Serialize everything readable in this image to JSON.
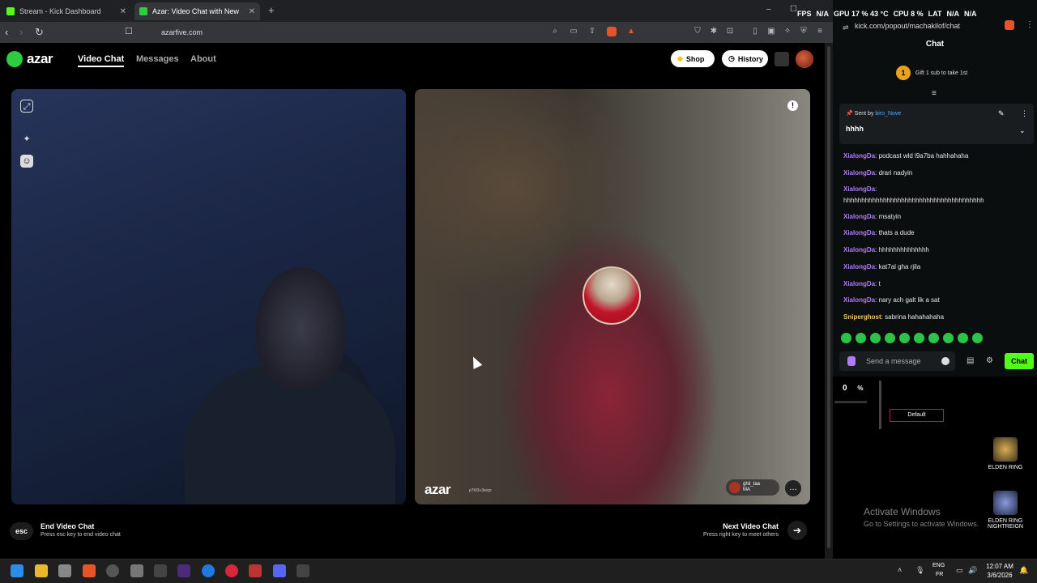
{
  "browser": {
    "tabs": [
      {
        "title": "Stream - Kick Dashboard",
        "favicon_color": "#53fc18"
      },
      {
        "title": "Azar: Video Chat with New Pe",
        "favicon_color": "#2ecc40"
      }
    ],
    "new_tab": "+",
    "url": "azarfive.com",
    "window_controls": [
      "–",
      "☐",
      "✕"
    ]
  },
  "azar": {
    "logo": "azar",
    "nav": {
      "video_chat": "Video Chat",
      "messages": "Messages",
      "about": "About"
    },
    "shop_label": "Shop",
    "history_label": "History",
    "watermark": "azar",
    "watermark_sub": "p7t03+3ieqo",
    "partner_tag_name": "ghii_taa",
    "partner_tag_country": "MA",
    "end": {
      "key": "esc",
      "title": "End Video Chat",
      "subtitle": "Press esc key to end video chat"
    },
    "next": {
      "title": "Next Video Chat",
      "subtitle": "Press right key to meet others",
      "arrow": "➔"
    }
  },
  "overlay": {
    "fps_label": "FPS",
    "fps_value": "N/A",
    "gpu": "GPU 17 % 43 °C",
    "cpu": "CPU 8 %",
    "lat_label": "LAT",
    "lat_value": "N/A",
    "extra": "N/A"
  },
  "chat": {
    "url": "kick.com/popout/machakilof/chat",
    "header": "Chat",
    "gift_badge": "1",
    "gift_text": "Gift 1 sub to take 1st",
    "pinned": {
      "sent_by": "Sent by",
      "user": "biro_Nove",
      "message": "hhhh"
    },
    "messages": [
      {
        "user": "XialongDa",
        "text": ": podcast wld l9a7ba hahhahaha"
      },
      {
        "user": "XialongDa",
        "text": ": drari nadyin"
      },
      {
        "user": "XialongDa",
        "text": ":"
      },
      {
        "user": "",
        "text": "hhhhhhhhhhhhhhhhhhhhhhhhhhhhhhhhhhhhhhh"
      },
      {
        "user": "XialongDa",
        "text": ": msatyin"
      },
      {
        "user": "XialongDa",
        "text": ": thats a dude"
      },
      {
        "user": "XialongDa",
        "text": ": hhhhhhhhhhhhhh"
      },
      {
        "user": "XialongDa",
        "text": ": kat7al gha rjila"
      },
      {
        "user": "XialongDa",
        "text": ": t"
      },
      {
        "user": "XialongDa",
        "text": ": nary ach galt lik a sat"
      },
      {
        "user": "Sniperghost",
        "text": ": sabrina hahahahaha"
      }
    ],
    "input_placeholder": "Send a message",
    "send_label": "Chat"
  },
  "desktop": {
    "zero_value": "0",
    "percent": "%",
    "default_label": "Default",
    "icons": [
      {
        "label": "ELDEN RING"
      },
      {
        "label": "ELDEN RING NIGHTREIGN"
      }
    ],
    "activate_title": "Activate Windows",
    "activate_sub": "Go to Settings to activate Windows."
  },
  "taskbar": {
    "lang_top": "ENG",
    "lang_bottom": "FR",
    "time": "12:07 AM",
    "date": "3/6/2026"
  }
}
